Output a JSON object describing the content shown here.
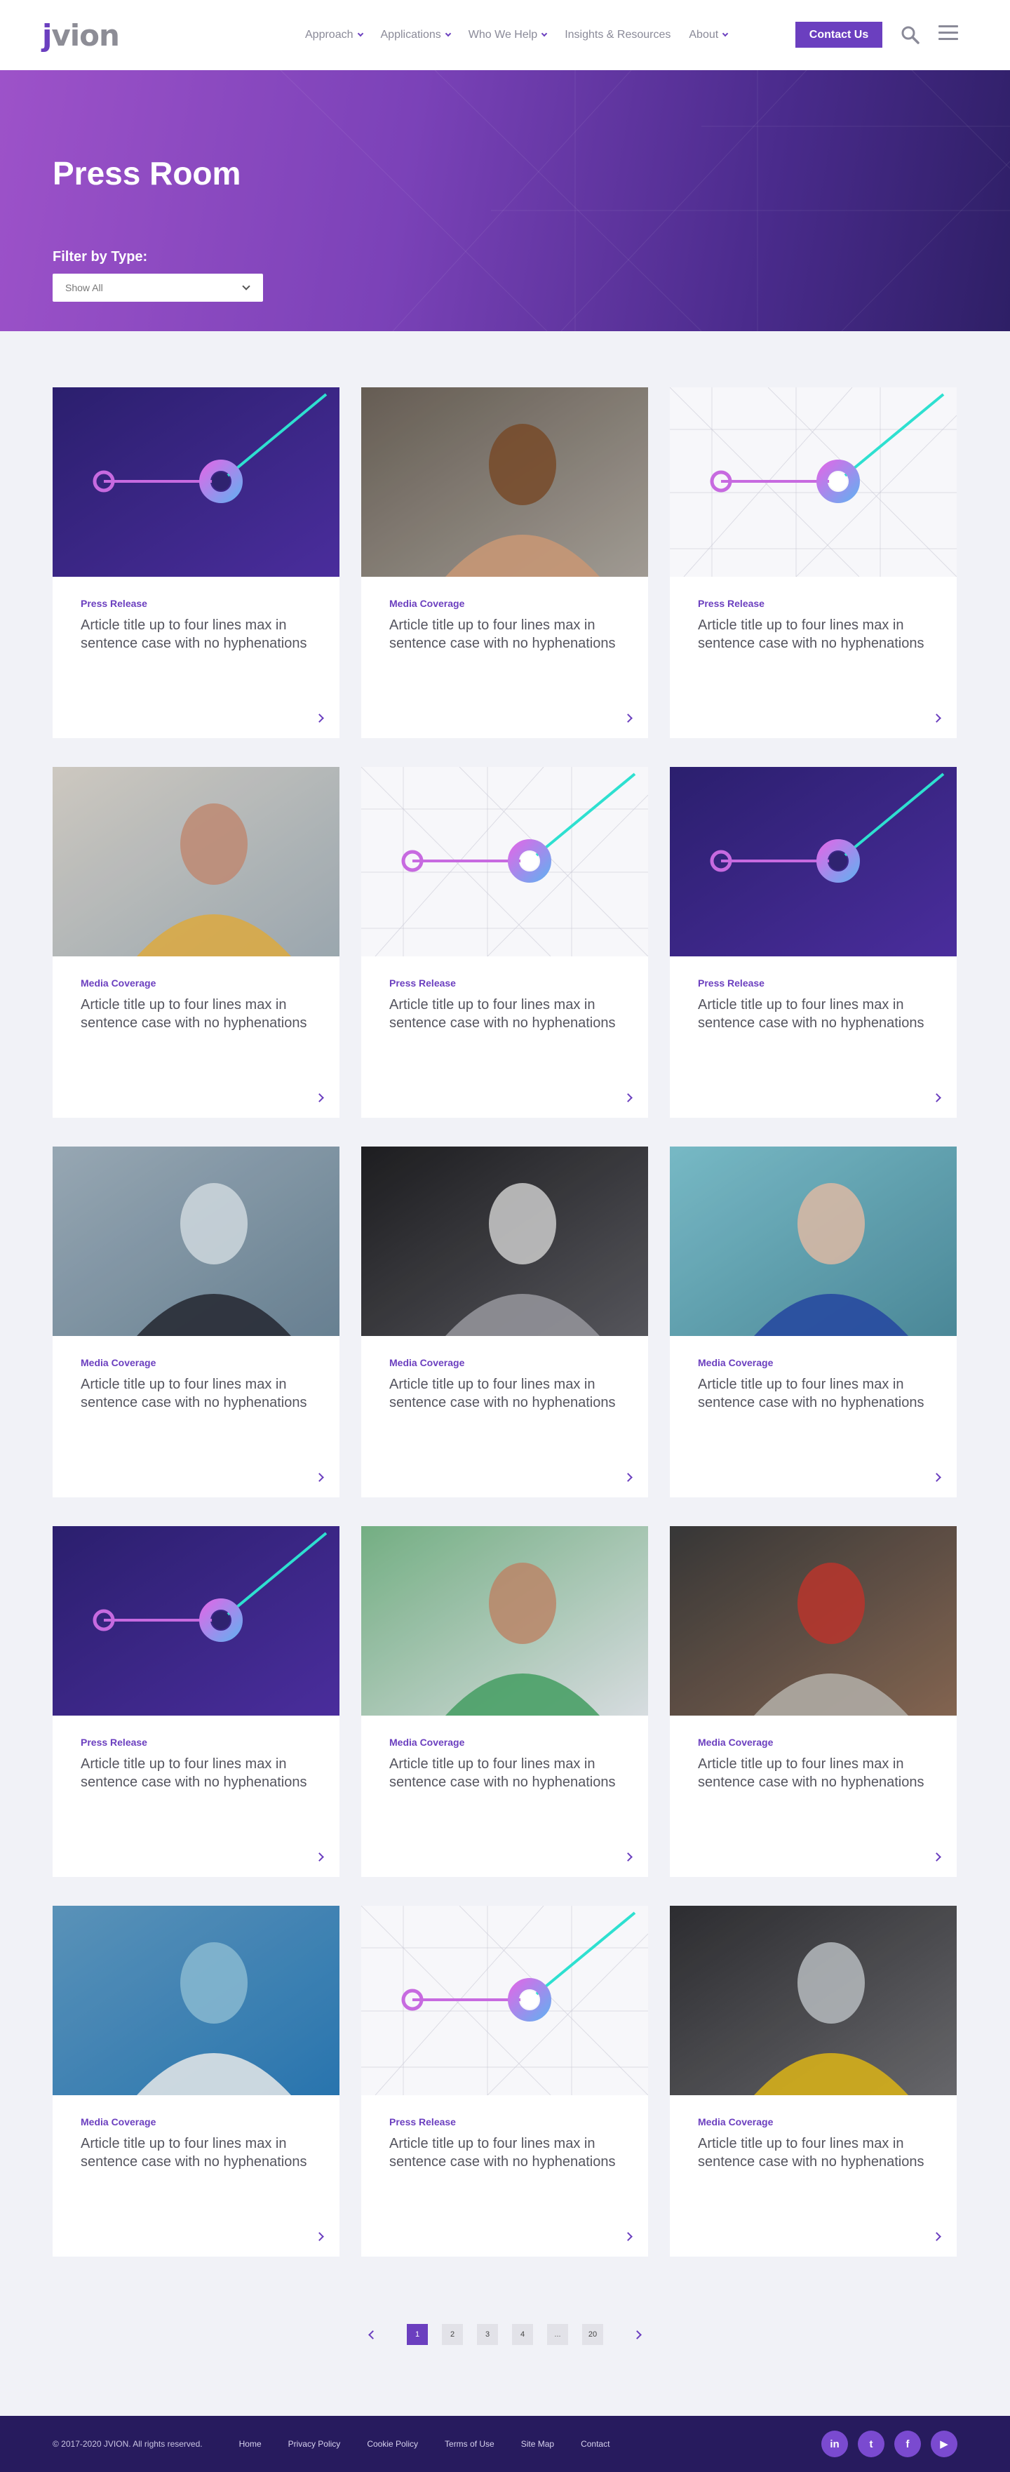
{
  "header": {
    "logo_text": "jvion",
    "nav": [
      {
        "label": "Approach",
        "has_dropdown": true
      },
      {
        "label": "Applications",
        "has_dropdown": true
      },
      {
        "label": "Who We Help",
        "has_dropdown": true
      },
      {
        "label": "Insights & Resources",
        "has_dropdown": false
      },
      {
        "label": "About",
        "has_dropdown": true
      }
    ],
    "contact_label": "Contact Us"
  },
  "hero": {
    "title": "Press Room",
    "filter_label": "Filter by Type:",
    "filter_value": "Show All"
  },
  "cards": [
    {
      "type": "Press Release",
      "title": "Article title up to four lines max in sentence case with no hyphenations",
      "image": "graphic-dark"
    },
    {
      "type": "Media Coverage",
      "title": "Article title up to four lines max in sentence case with no hyphenations",
      "image": "photo-women-embrace"
    },
    {
      "type": "Press Release",
      "title": "Article title up to four lines max in sentence case with no hyphenations",
      "image": "graphic-light"
    },
    {
      "type": "Media Coverage",
      "title": "Article title up to four lines max in sentence case with no hyphenations",
      "image": "photo-pill-bottle"
    },
    {
      "type": "Press Release",
      "title": "Article title up to four lines max in sentence case with no hyphenations",
      "image": "graphic-light"
    },
    {
      "type": "Press Release",
      "title": "Article title up to four lines max in sentence case with no hyphenations",
      "image": "graphic-dark"
    },
    {
      "type": "Media Coverage",
      "title": "Article title up to four lines max in sentence case with no hyphenations",
      "image": "photo-woman-mask"
    },
    {
      "type": "Media Coverage",
      "title": "Article title up to four lines max in sentence case with no hyphenations",
      "image": "photo-car-driver"
    },
    {
      "type": "Media Coverage",
      "title": "Article title up to four lines max in sentence case with no hyphenations",
      "image": "photo-surgeon"
    },
    {
      "type": "Press Release",
      "title": "Article title up to four lines max in sentence case with no hyphenations",
      "image": "graphic-dark"
    },
    {
      "type": "Media Coverage",
      "title": "Article title up to four lines max in sentence case with no hyphenations",
      "image": "photo-vaccination"
    },
    {
      "type": "Media Coverage",
      "title": "Article title up to four lines max in sentence case with no hyphenations",
      "image": "photo-laptop-mask"
    },
    {
      "type": "Media Coverage",
      "title": "Article title up to four lines max in sentence case with no hyphenations",
      "image": "photo-surgical-team"
    },
    {
      "type": "Press Release",
      "title": "Article title up to four lines max in sentence case with no hyphenations",
      "image": "graphic-light"
    },
    {
      "type": "Media Coverage",
      "title": "Article title up to four lines max in sentence case with no hyphenations",
      "image": "photo-bus-passenger"
    }
  ],
  "pagination": {
    "pages": [
      "1",
      "2",
      "3",
      "4"
    ],
    "ellipsis": "...",
    "last": "20",
    "current": "1"
  },
  "footer": {
    "copyright": "© 2017-2020 JVION. All rights reserved.",
    "links": [
      "Home",
      "Privacy Policy",
      "Cookie Policy",
      "Terms of Use",
      "Site Map",
      "Contact"
    ],
    "socials": [
      {
        "icon": "linkedin-icon",
        "glyph": "in"
      },
      {
        "icon": "twitter-icon",
        "glyph": "t"
      },
      {
        "icon": "facebook-icon",
        "glyph": "f"
      },
      {
        "icon": "youtube-icon",
        "glyph": "▶"
      }
    ]
  },
  "colors": {
    "brand_purple": "#6b3fbf",
    "hero_start": "#9d52c9",
    "hero_end": "#2e1f66",
    "footer_bg": "#271b5e",
    "accent_teal": "#2ee0d0"
  }
}
